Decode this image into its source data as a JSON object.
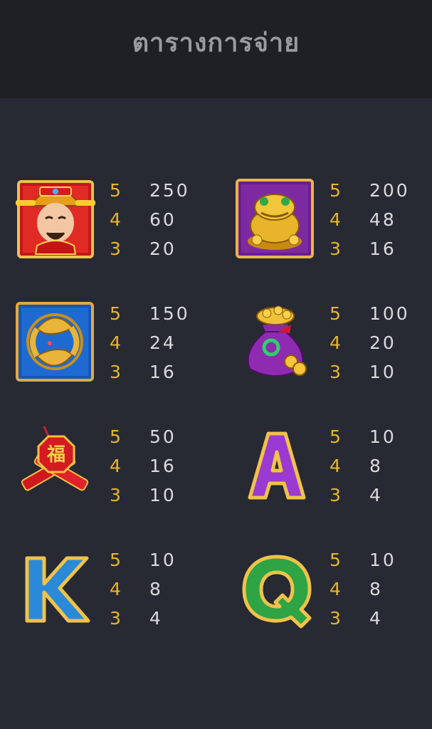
{
  "header": {
    "title": "ตารางการจ่าย"
  },
  "colors": {
    "background": "#272a33",
    "header_bg": "#1f2024",
    "count_color": "#e8b52a",
    "value_color": "#d9dadd"
  },
  "paytable": [
    {
      "symbol": "god-of-wealth-icon",
      "rows": [
        {
          "count": "5",
          "value": "250"
        },
        {
          "count": "4",
          "value": "60"
        },
        {
          "count": "3",
          "value": "20"
        }
      ]
    },
    {
      "symbol": "golden-toad-icon",
      "rows": [
        {
          "count": "5",
          "value": "200"
        },
        {
          "count": "4",
          "value": "48"
        },
        {
          "count": "3",
          "value": "16"
        }
      ]
    },
    {
      "symbol": "golden-koi-icon",
      "rows": [
        {
          "count": "5",
          "value": "150"
        },
        {
          "count": "4",
          "value": "24"
        },
        {
          "count": "3",
          "value": "16"
        }
      ]
    },
    {
      "symbol": "money-bag-icon",
      "rows": [
        {
          "count": "5",
          "value": "100"
        },
        {
          "count": "4",
          "value": "20"
        },
        {
          "count": "3",
          "value": "10"
        }
      ]
    },
    {
      "symbol": "firecracker-icon",
      "rows": [
        {
          "count": "5",
          "value": "50"
        },
        {
          "count": "4",
          "value": "16"
        },
        {
          "count": "3",
          "value": "10"
        }
      ]
    },
    {
      "symbol": "letter-a-icon",
      "rows": [
        {
          "count": "5",
          "value": "10"
        },
        {
          "count": "4",
          "value": "8"
        },
        {
          "count": "3",
          "value": "4"
        }
      ]
    },
    {
      "symbol": "letter-k-icon",
      "rows": [
        {
          "count": "5",
          "value": "10"
        },
        {
          "count": "4",
          "value": "8"
        },
        {
          "count": "3",
          "value": "4"
        }
      ]
    },
    {
      "symbol": "letter-q-icon",
      "rows": [
        {
          "count": "5",
          "value": "10"
        },
        {
          "count": "4",
          "value": "8"
        },
        {
          "count": "3",
          "value": "4"
        }
      ]
    }
  ]
}
